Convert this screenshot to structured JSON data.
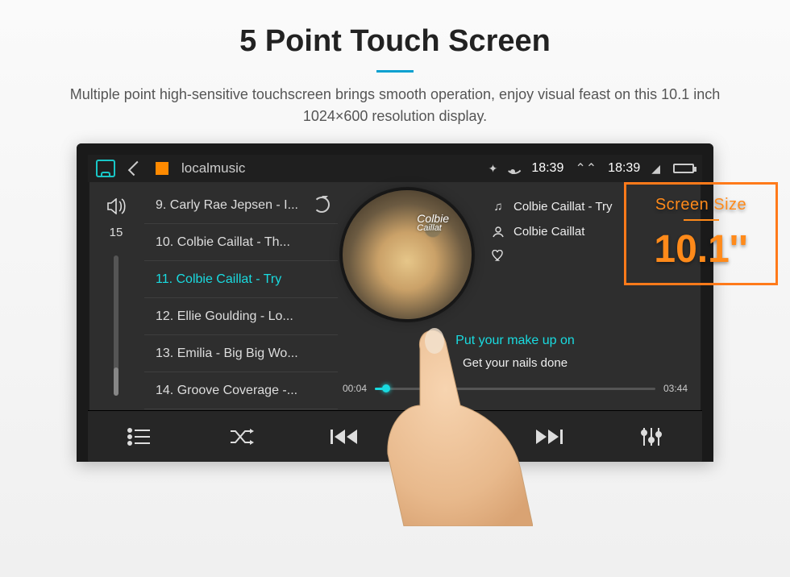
{
  "marketing": {
    "headline": "5 Point Touch Screen",
    "subhead": "Multiple point high-sensitive touchscreen brings smooth operation, enjoy visual feast on this 10.1 inch 1024×600 resolution display."
  },
  "callout": {
    "label": "Screen Size",
    "value": "10.1''"
  },
  "statusbar": {
    "app_title": "localmusic",
    "time_left": "18:39",
    "time_right": "18:39"
  },
  "volume": {
    "level": "15"
  },
  "playlist": {
    "items": [
      "9. Carly Rae Jepsen - I...",
      "10. Colbie Caillat - Th...",
      "11. Colbie Caillat - Try",
      "12. Ellie Goulding - Lo...",
      "13. Emilia - Big Big Wo...",
      "14. Groove Coverage -..."
    ],
    "active_index": 2
  },
  "nowplaying": {
    "song": "Colbie Caillat - Try",
    "artist": "Colbie Caillat",
    "cover_label_line1": "Colbie",
    "cover_label_line2": "Caillat",
    "lyric_current": "Put your make up on",
    "lyric_next": "Get your nails done",
    "time_elapsed": "00:04",
    "time_total": "03:44"
  },
  "controls": {
    "list": "list",
    "shuffle": "shuffle",
    "prev": "prev",
    "pause": "pause",
    "next": "next",
    "eq": "eq"
  }
}
